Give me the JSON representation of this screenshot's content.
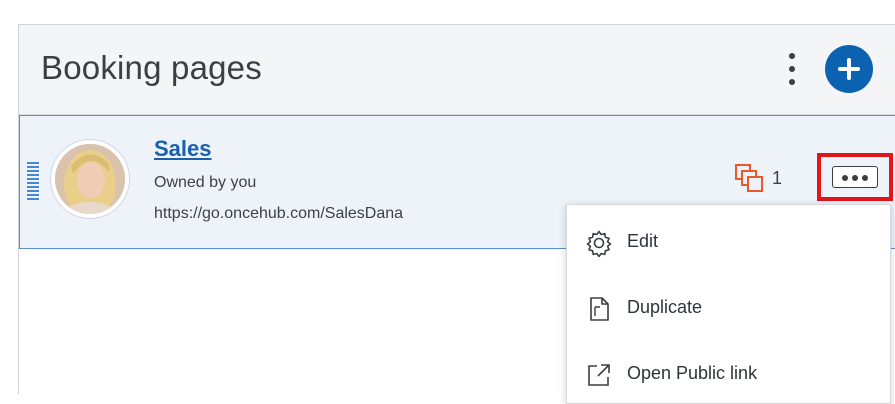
{
  "header": {
    "title": "Booking pages"
  },
  "booking_pages": [
    {
      "name": "Sales",
      "owner": "Owned by you",
      "url": "https://go.oncehub.com/SalesDana",
      "copies_count": "1"
    }
  ],
  "context_menu": {
    "items": [
      {
        "label": "Edit",
        "icon": "gear-icon"
      },
      {
        "label": "Duplicate",
        "icon": "document-icon"
      },
      {
        "label": "Open Public link",
        "icon": "external-link-icon"
      }
    ]
  },
  "colors": {
    "accent": "#0a62b0",
    "highlight": "#e4141b",
    "copies_icon": "#e8582a"
  }
}
